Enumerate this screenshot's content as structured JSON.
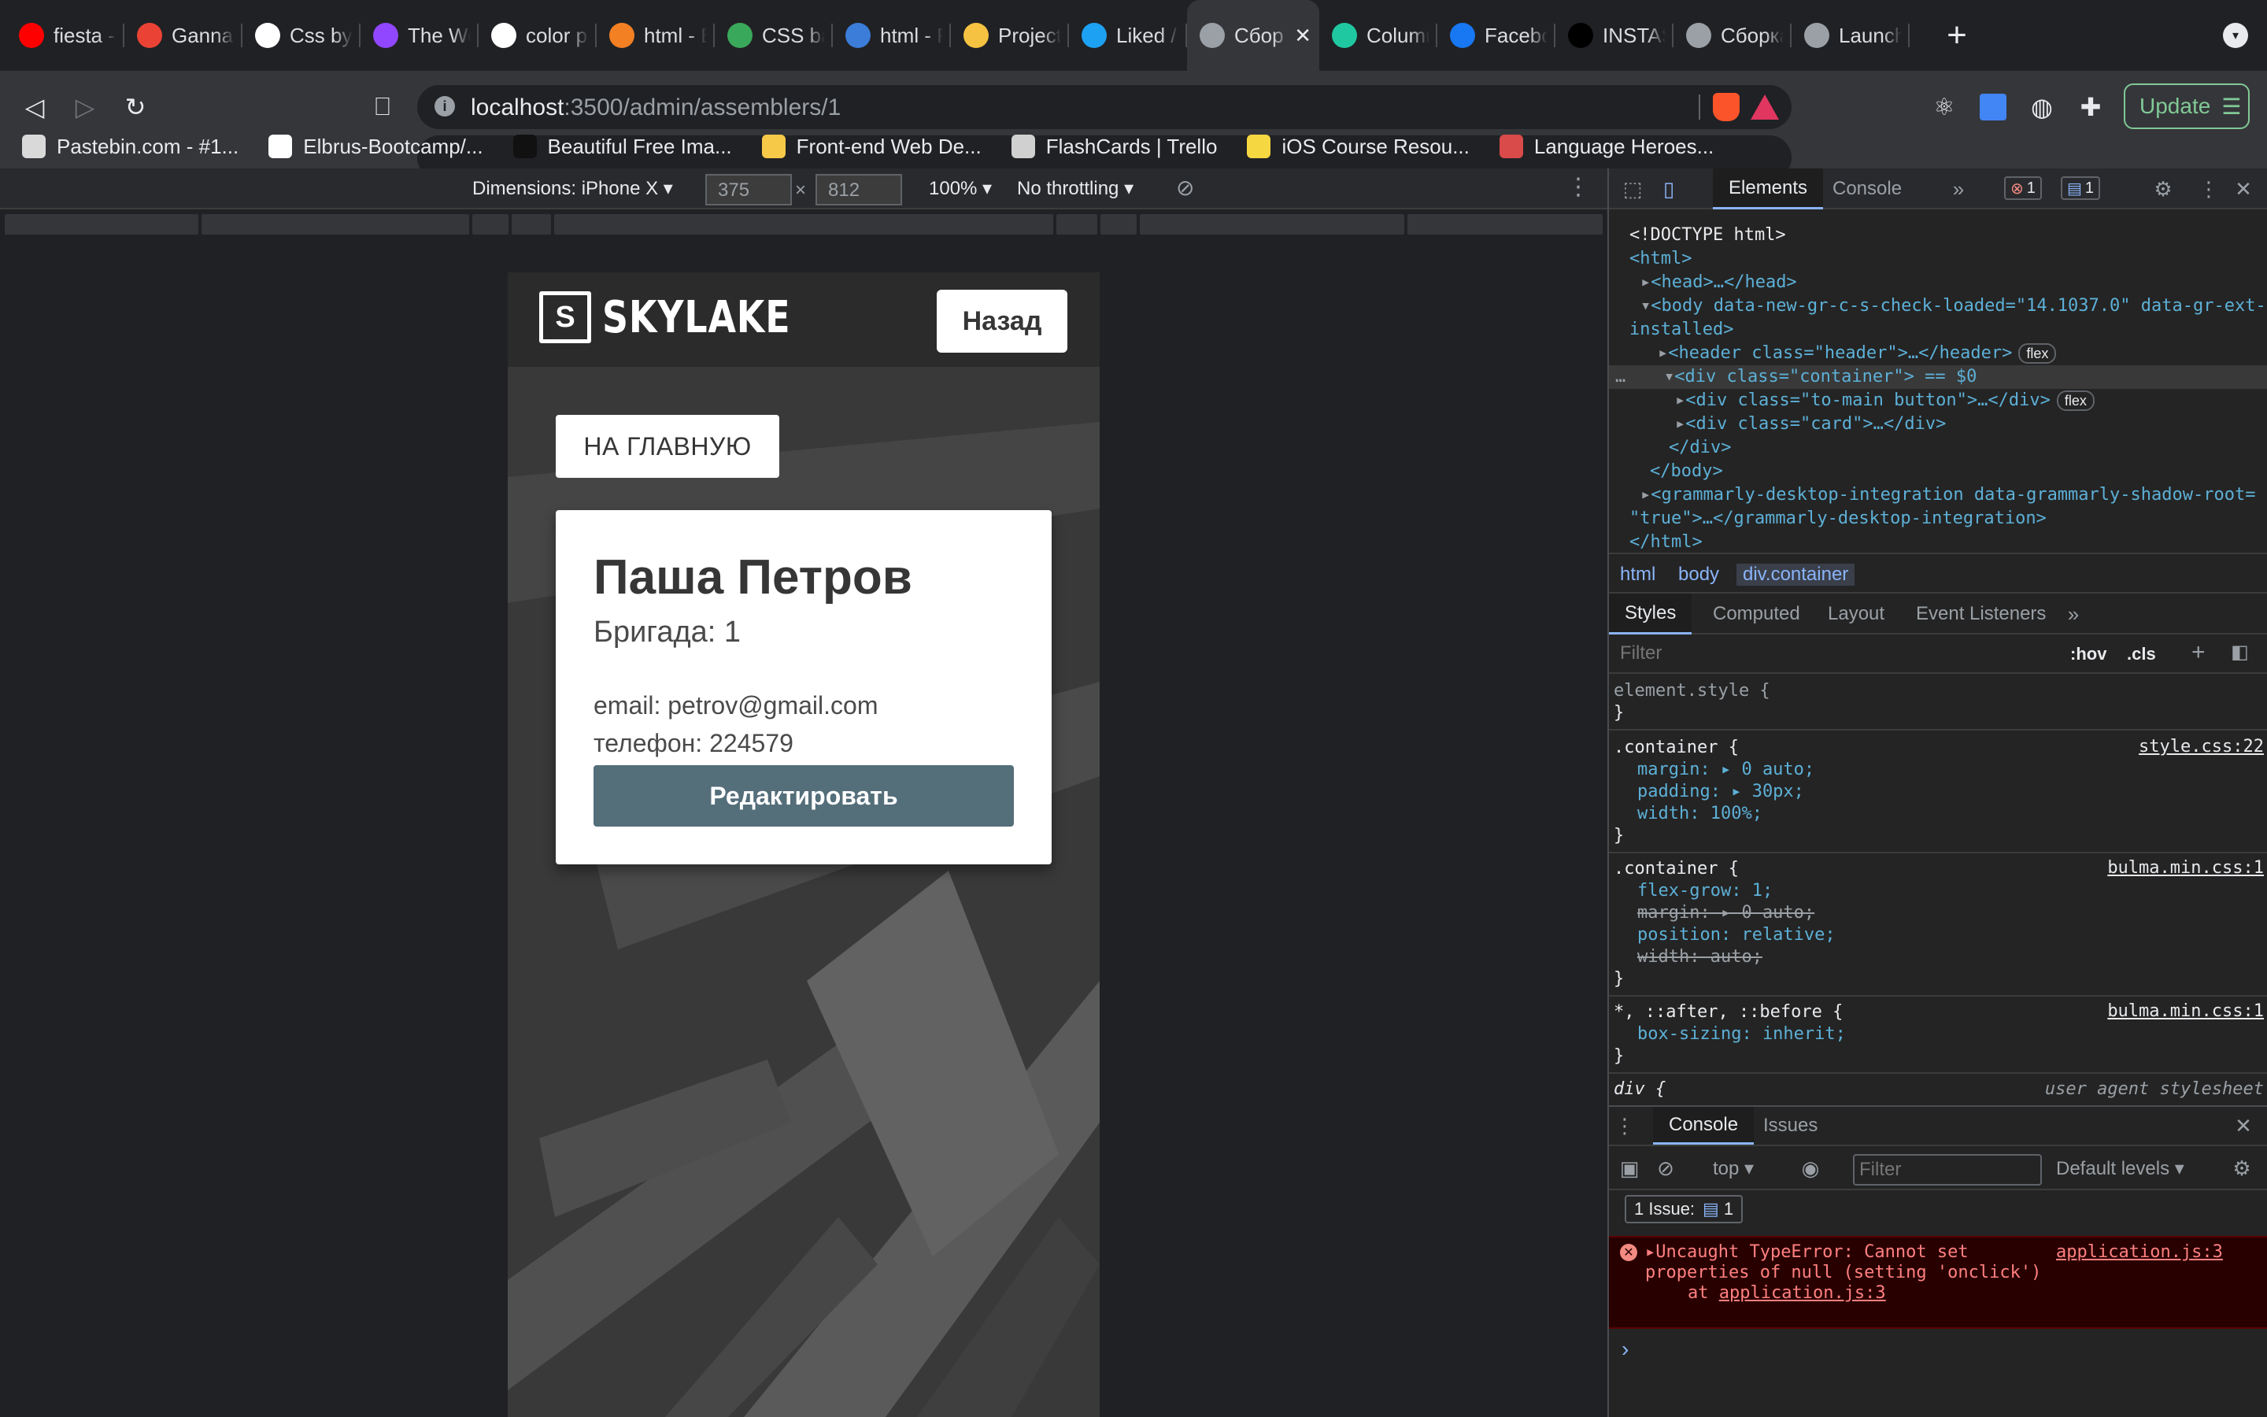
{
  "browser": {
    "tabs": [
      {
        "label": "fiesta - ",
        "icon": "youtube-icon",
        "color": "#ff0000"
      },
      {
        "label": "GannaS",
        "icon": "gmail-icon",
        "color": "#ea4335"
      },
      {
        "label": "Css by I",
        "icon": "github-icon",
        "color": "#ffffff"
      },
      {
        "label": "The Web",
        "icon": "webdev-icon",
        "color": "#9146ff"
      },
      {
        "label": "color pic",
        "icon": "google-icon",
        "color": "#ffffff"
      },
      {
        "label": "html - B",
        "icon": "stackoverflow-icon",
        "color": "#f48024"
      },
      {
        "label": "CSS bac",
        "icon": "zeplin-icon",
        "color": "#3aa85a"
      },
      {
        "label": "html - P",
        "icon": "stackexchange-icon",
        "color": "#3b7dd8"
      },
      {
        "label": "Project",
        "icon": "project-icon",
        "color": "#f5c242"
      },
      {
        "label": "Liked / T",
        "icon": "twitter-icon",
        "color": "#1da1f2"
      },
      {
        "label": "Сбор",
        "icon": "globe-icon",
        "color": "#9aa0a6",
        "active": true
      },
      {
        "label": "Column",
        "icon": "column-icon",
        "color": "#1fc8a0"
      },
      {
        "label": "Facebo",
        "icon": "facebook-icon",
        "color": "#1877f2"
      },
      {
        "label": "INSTAS/",
        "icon": "instas-icon",
        "color": "#000000"
      },
      {
        "label": "Сборка",
        "icon": "globe-icon",
        "color": "#9aa0a6"
      },
      {
        "label": "Launch",
        "icon": "globe-icon",
        "color": "#9aa0a6"
      }
    ],
    "new_tab_label": "+",
    "url_host": "localhost",
    "url_path": ":3500/admin/assemblers/1",
    "update_label": "Update",
    "bookmarks": [
      {
        "label": "Pastebin.com - #1...",
        "color": "#d9d9d9"
      },
      {
        "label": "Elbrus-Bootcamp/...",
        "color": "#ffffff"
      },
      {
        "label": "Beautiful Free Ima...",
        "color": "#111111"
      },
      {
        "label": "Front-end Web De...",
        "color": "#f7c948"
      },
      {
        "label": "FlashCards | Trello",
        "color": "#d0d0d0"
      },
      {
        "label": "iOS Course Resou...",
        "color": "#f5d742"
      },
      {
        "label": "Language Heroes...",
        "color": "#d94a4a"
      }
    ]
  },
  "device_toolbar": {
    "dimensions_label": "Dimensions: iPhone X",
    "width": "375",
    "height": "812",
    "times": "×",
    "zoom": "100%",
    "throttling": "No throttling"
  },
  "page": {
    "logo_mark": "S",
    "logo_text": "SKYLAKE",
    "back_button": "Назад",
    "main_button": "НА ГЛАВНУЮ",
    "card": {
      "name": "Паша Петров",
      "brigade": "Бригада: 1",
      "email": "email: petrov@gmail.com",
      "phone": "телефон: 224579",
      "edit_button": "Редактировать"
    }
  },
  "devtools": {
    "tabs": [
      "Elements",
      "Console"
    ],
    "error_count": "1",
    "message_count": "1",
    "dom_lines": {
      "doctype": "<!DOCTYPE html>",
      "html_open": "<html>",
      "head": "<head>…</head>",
      "body_open_1": "<body data-new-gr-c-s-check-loaded=\"14.1037.0\" data-gr-ext-",
      "body_open_2": "installed>",
      "header": "<header class=\"header\">…</header>",
      "container": "<div class=\"container\"> == $0",
      "to_main": "<div class=\"to-main button\">…</div>",
      "card": "<div class=\"card\">…</div>",
      "div_close": "</div>",
      "body_close": "</body>",
      "grammarly_1": "<grammarly-desktop-integration data-grammarly-shadow-root=",
      "grammarly_2": "\"true\">…</grammarly-desktop-integration>",
      "html_close": "</html>",
      "flex_pill": "flex"
    },
    "breadcrumbs": [
      "html",
      "body",
      "div.container"
    ],
    "style_tabs": [
      "Styles",
      "Computed",
      "Layout",
      "Event Listeners"
    ],
    "filter_placeholder": "Filter",
    "hov": ":hov",
    "cls": ".cls",
    "rules": {
      "element_style": "element.style {",
      "close": "}",
      "c1_selector": ".container {",
      "c1_source": "style.css:22",
      "c1_props": [
        "margin: ▸ 0 auto;",
        "padding: ▸ 30px;",
        "width: 100%;"
      ],
      "c2_selector": ".container {",
      "c2_source": "bulma.min.css:1",
      "c2_props": [
        "flex-grow: 1;",
        "margin: ▸ 0 auto;",
        "position: relative;",
        "width: auto;"
      ],
      "c3_selector": "*, ::after, ::before {",
      "c3_source": "bulma.min.css:1",
      "c3_props": [
        "box-sizing: inherit;"
      ],
      "c4_selector": "div {",
      "c4_source": "user agent stylesheet"
    },
    "drawer": {
      "tabs": [
        "Console",
        "Issues"
      ],
      "context": "top",
      "filter_placeholder": "Filter",
      "levels": "Default levels",
      "issues_label": "1 Issue:",
      "issues_count": "1",
      "error_text_1": "Uncaught TypeError: Cannot set",
      "error_text_2": "properties of null (setting 'onclick')",
      "error_text_3": "at",
      "error_source": "application.js:3",
      "error_link": "application.js:3",
      "prompt": "›"
    }
  }
}
